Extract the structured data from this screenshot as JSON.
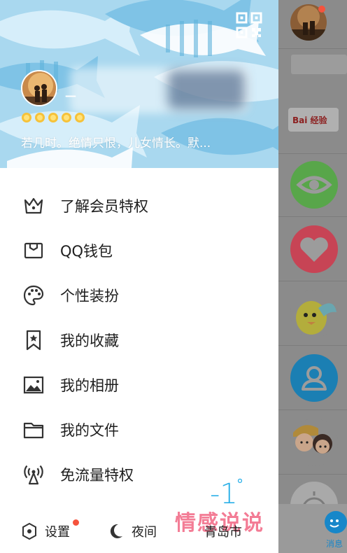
{
  "profile": {
    "nickname_prefix": "_",
    "level_icons": [
      "sun-icon",
      "sun-icon",
      "sun-icon",
      "sun-icon",
      "sun-icon"
    ],
    "signature": "若几时。绝情只恨，儿女情长。默..."
  },
  "menu": {
    "items": [
      {
        "label": "了解会员特权",
        "icon": "crown-icon"
      },
      {
        "label": "QQ钱包",
        "icon": "wallet-icon"
      },
      {
        "label": "个性装扮",
        "icon": "palette-icon"
      },
      {
        "label": "我的收藏",
        "icon": "bookmark-star-icon"
      },
      {
        "label": "我的相册",
        "icon": "image-icon"
      },
      {
        "label": "我的文件",
        "icon": "folder-icon"
      },
      {
        "label": "免流量特权",
        "icon": "signal-tower-icon"
      }
    ]
  },
  "bottom": {
    "settings_label": "设置",
    "night_label": "夜间",
    "city": "青岛市"
  },
  "weather": {
    "temperature": "-1",
    "unit": "°"
  },
  "watermark": "情感说说",
  "background_app": {
    "tab_label": "消息",
    "badge_text": "Bai 经验"
  },
  "colors": {
    "header_bg": "#a9d8ef",
    "accent_blue": "#2bb0e8",
    "notification_red": "#f5533d",
    "dim_overlay": "#8b8b8b"
  }
}
